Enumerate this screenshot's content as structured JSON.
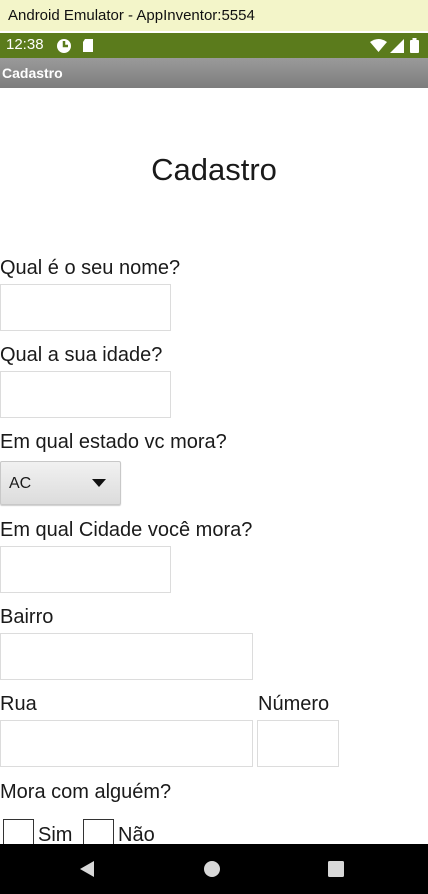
{
  "window": {
    "title": "Android Emulator - AppInventor:5554"
  },
  "status_bar": {
    "time": "12:38"
  },
  "app_bar": {
    "title": "Cadastro"
  },
  "form": {
    "heading": "Cadastro",
    "name_label": "Qual é o seu nome?",
    "name_value": "",
    "age_label": "Qual a sua idade?",
    "age_value": "",
    "state_label": "Em qual estado vc mora?",
    "state_selected": "AC",
    "city_label": "Em qual Cidade você mora?",
    "city_value": "",
    "district_label": "Bairro",
    "district_value": "",
    "street_label": "Rua",
    "street_value": "",
    "number_label": "Número",
    "number_value": "",
    "lives_with_label": "Mora com alguém?",
    "yes_label": "Sim",
    "no_label": "Não"
  },
  "icons": [
    "wifi-icon",
    "signal-icon",
    "battery-icon",
    "back-icon",
    "home-icon",
    "recents-icon"
  ]
}
